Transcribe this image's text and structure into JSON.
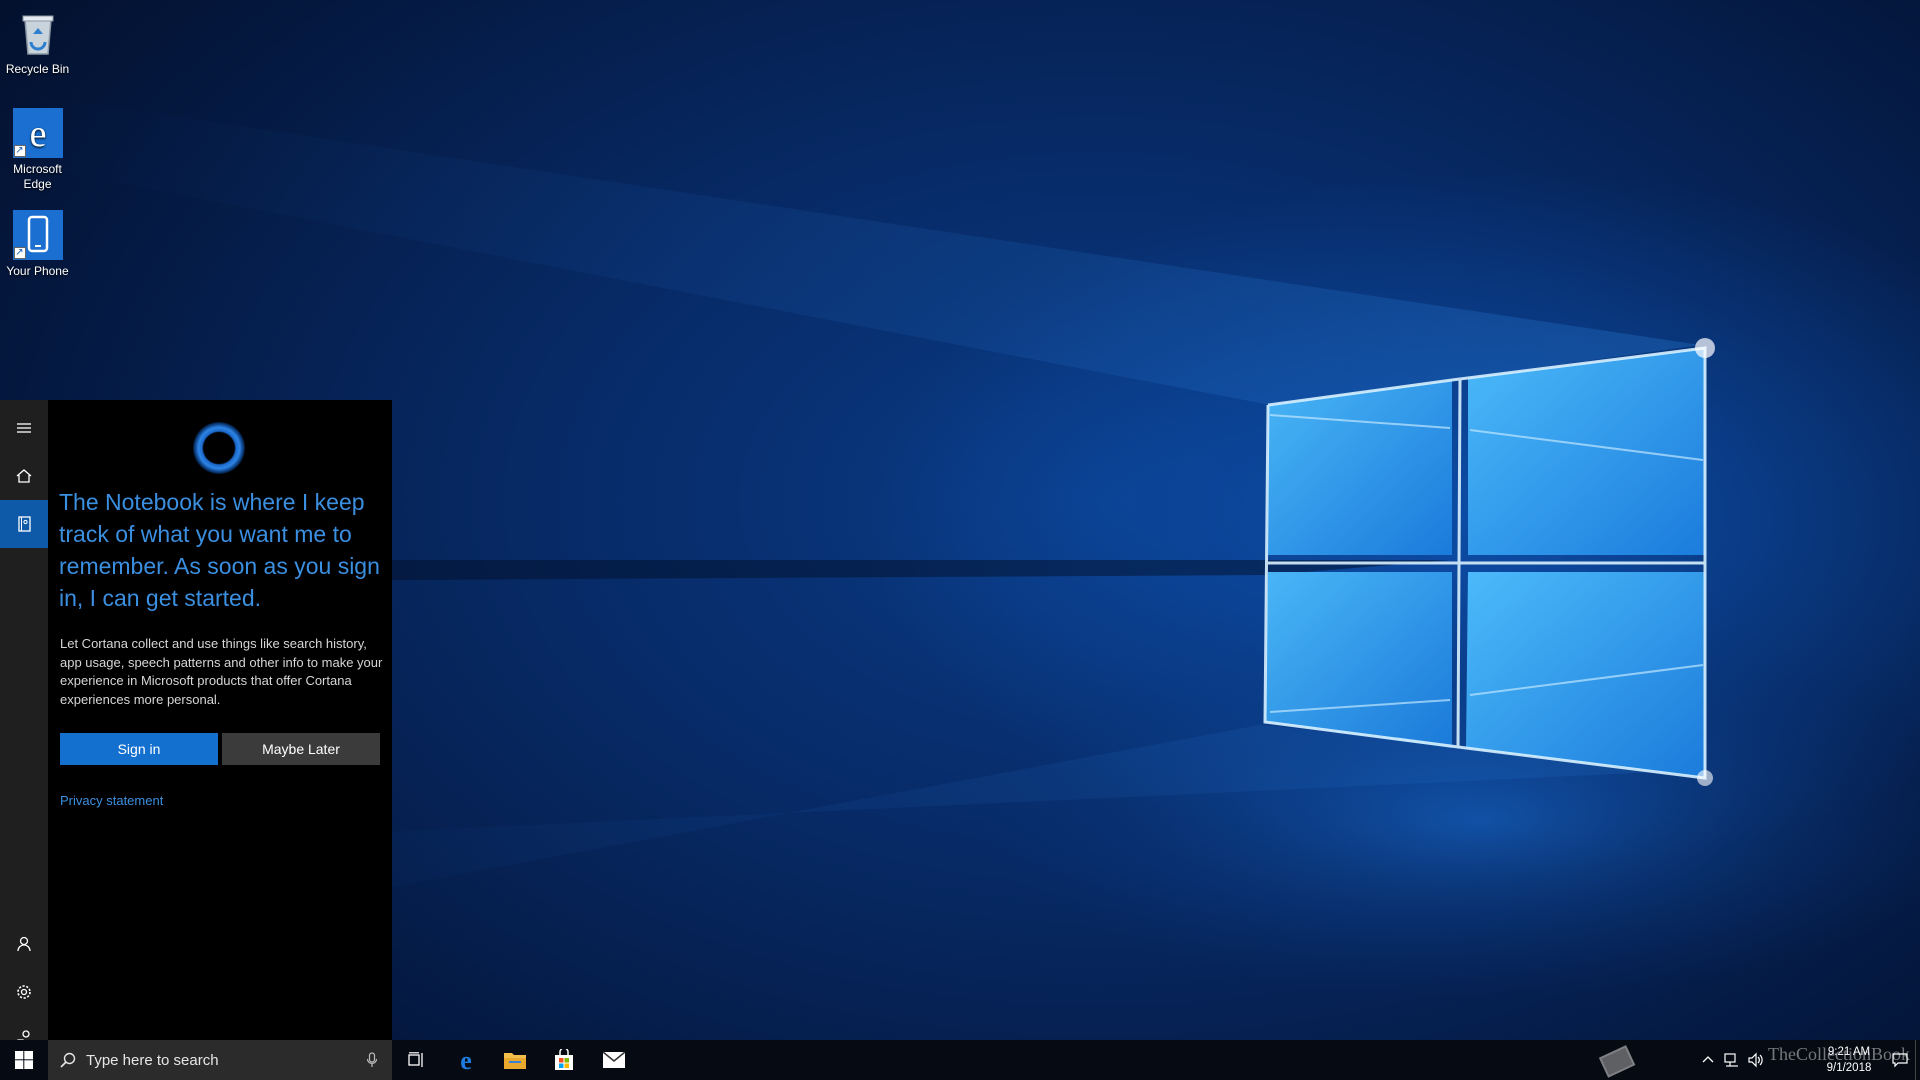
{
  "desktop": {
    "icons": [
      {
        "label": "Recycle Bin",
        "icon": "recycle-bin-icon"
      },
      {
        "label": "Microsoft Edge",
        "icon": "edge-icon"
      },
      {
        "label": "Your Phone",
        "icon": "phone-icon"
      }
    ]
  },
  "cortana": {
    "rail": [
      {
        "icon": "hamburger-menu-icon",
        "label": "Menu"
      },
      {
        "icon": "home-icon",
        "label": "Home"
      },
      {
        "icon": "notebook-icon",
        "label": "Notebook",
        "active": true
      },
      {
        "icon": "account-icon",
        "label": "Account"
      },
      {
        "icon": "gear-icon",
        "label": "Settings"
      },
      {
        "icon": "feedback-icon",
        "label": "Feedback"
      }
    ],
    "heading": "The Notebook is where I keep track of what you want me to remember. As soon as you sign in, I can get started.",
    "description": "Let Cortana collect and use things like search history, app usage, speech patterns and other info to make your experience in Microsoft products that offer Cortana experiences more personal.",
    "sign_in_label": "Sign in",
    "maybe_later_label": "Maybe Later",
    "privacy_label": "Privacy statement",
    "accent_color": "#3b8fe0"
  },
  "taskbar": {
    "start_icon": "windows-logo-icon",
    "search": {
      "placeholder": "Type here to search",
      "icon": "search-icon",
      "mic_icon": "microphone-icon"
    },
    "pinned": [
      {
        "icon": "task-view-icon"
      },
      {
        "icon": "edge-icon"
      },
      {
        "icon": "file-explorer-icon"
      },
      {
        "icon": "store-icon"
      },
      {
        "icon": "mail-icon"
      }
    ],
    "clock": {
      "time": "9:21 AM",
      "date": "9/1/2018"
    },
    "watermark": "TheCollectionBook",
    "tray_icons": [
      "chevron-up-icon",
      "network-icon",
      "volume-icon",
      "action-center-icon"
    ]
  }
}
